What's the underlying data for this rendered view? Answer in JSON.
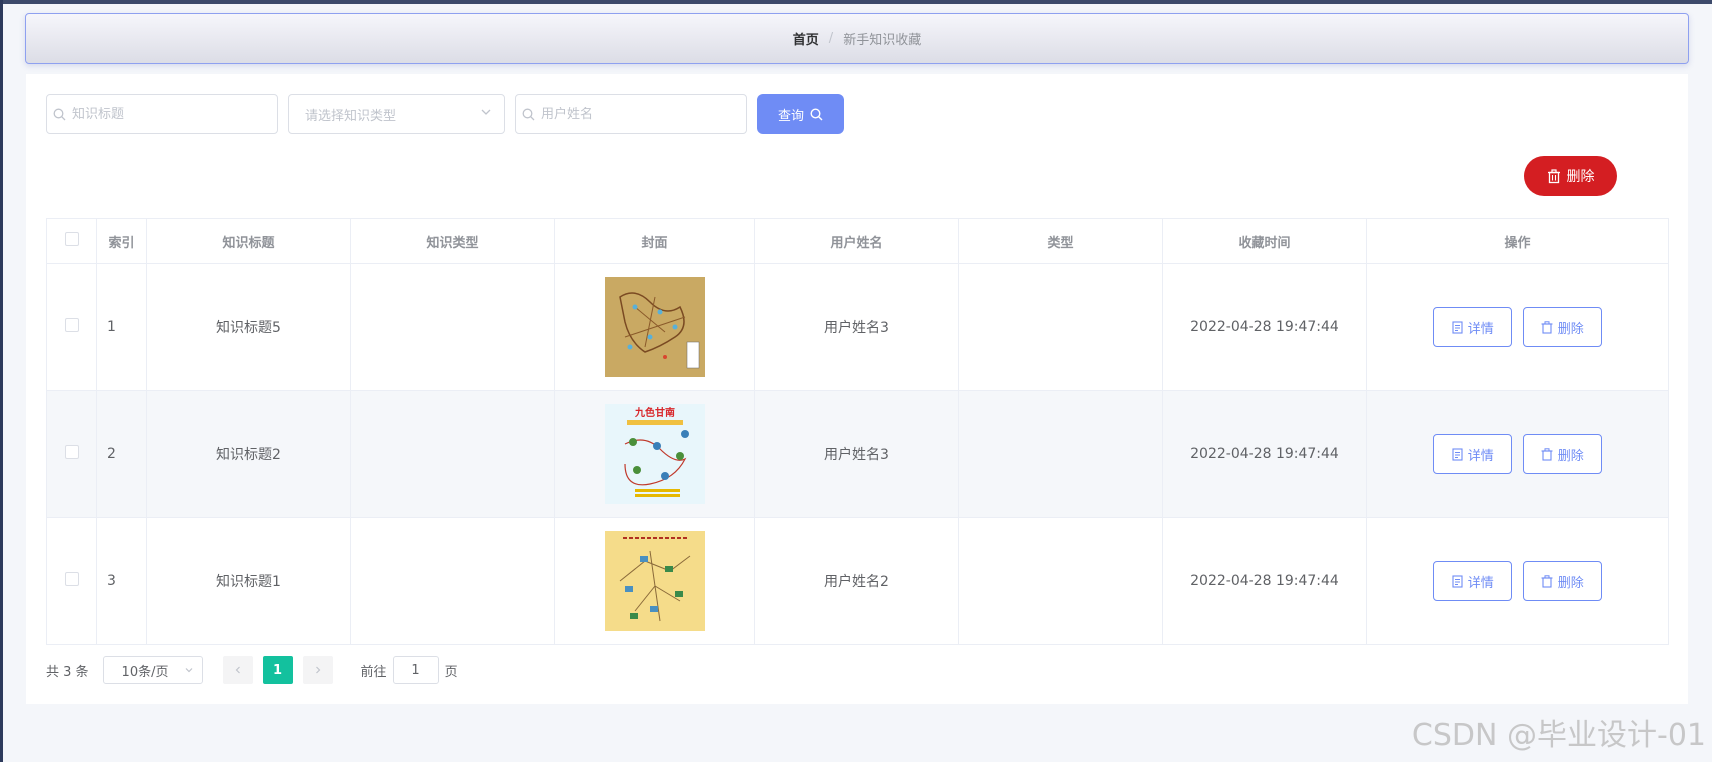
{
  "breadcrumb": {
    "home": "首页",
    "separator": "/",
    "current": "新手知识收藏"
  },
  "search": {
    "title_placeholder": "知识标题",
    "type_placeholder": "请选择知识类型",
    "user_placeholder": "用户姓名",
    "query_label": "查询"
  },
  "toolbar": {
    "delete_label": "删除"
  },
  "table": {
    "headers": [
      "",
      "索引",
      "知识标题",
      "知识类型",
      "封面",
      "用户姓名",
      "类型",
      "收藏时间",
      "操作"
    ],
    "rows": [
      {
        "index": "1",
        "title": "知识标题5",
        "ktype": "",
        "user": "用户姓名3",
        "type": "",
        "time": "2022-04-28 19:47:44"
      },
      {
        "index": "2",
        "title": "知识标题2",
        "ktype": "",
        "user": "用户姓名3",
        "type": "",
        "time": "2022-04-28 19:47:44"
      },
      {
        "index": "3",
        "title": "知识标题1",
        "ktype": "",
        "user": "用户姓名2",
        "type": "",
        "time": "2022-04-28 19:47:44"
      }
    ],
    "row_actions": {
      "detail": "详情",
      "delete": "删除"
    }
  },
  "pagination": {
    "total": "共 3 条",
    "page_size": "10条/页",
    "current_page": "1",
    "goto_prefix": "前往",
    "goto_value": "1",
    "goto_suffix": "页"
  },
  "watermark": "CSDN @毕业设计-01",
  "colors": {
    "primary": "#6f8cf5",
    "danger": "#d41e22",
    "active_page": "#13c19e"
  }
}
